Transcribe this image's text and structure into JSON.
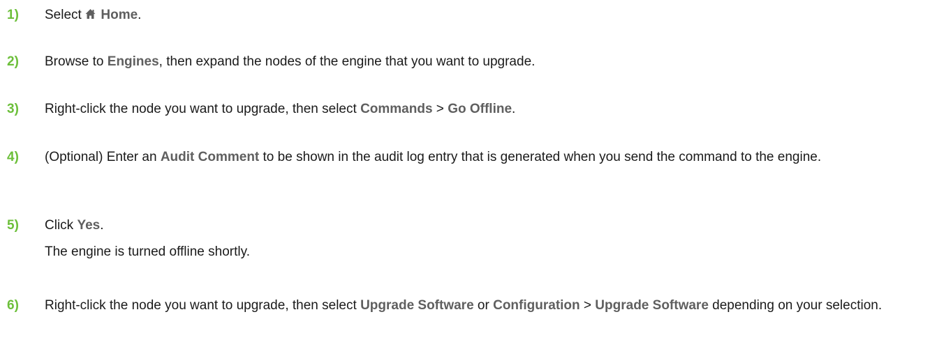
{
  "steps": [
    {
      "number": "1)",
      "parts": [
        {
          "type": "text",
          "text": "Select "
        },
        {
          "type": "icon",
          "icon": "home-icon"
        },
        {
          "type": "ui",
          "text": " Home"
        },
        {
          "type": "text",
          "text": "."
        }
      ]
    },
    {
      "number": "2)",
      "parts": [
        {
          "type": "text",
          "text": "Browse to "
        },
        {
          "type": "ui",
          "text": "Engines"
        },
        {
          "type": "text",
          "text": ", then expand the nodes of the engine that you want to upgrade."
        }
      ]
    },
    {
      "number": "3)",
      "parts": [
        {
          "type": "text",
          "text": "Right-click the node you want to upgrade, then select "
        },
        {
          "type": "ui",
          "text": "Commands"
        },
        {
          "type": "text",
          "text": " > "
        },
        {
          "type": "ui",
          "text": "Go Offline"
        },
        {
          "type": "text",
          "text": "."
        }
      ]
    },
    {
      "number": "4)",
      "parts": [
        {
          "type": "text",
          "text": "(Optional) Enter an "
        },
        {
          "type": "ui",
          "text": "Audit Comment"
        },
        {
          "type": "text",
          "text": " to be shown in the audit log entry that is generated when you send the command to the engine."
        }
      ]
    },
    {
      "number": "5)",
      "parts": [
        {
          "type": "text",
          "text": "Click "
        },
        {
          "type": "ui",
          "text": "Yes"
        },
        {
          "type": "text",
          "text": "."
        }
      ],
      "result": "The engine is turned offline shortly."
    },
    {
      "number": "6)",
      "parts": [
        {
          "type": "text",
          "text": "Right-click the node you want to upgrade, then select "
        },
        {
          "type": "ui",
          "text": "Upgrade Software"
        },
        {
          "type": "text",
          "text": " or "
        },
        {
          "type": "ui",
          "text": "Configuration"
        },
        {
          "type": "text",
          "text": " > "
        },
        {
          "type": "ui",
          "text": "Upgrade Software"
        },
        {
          "type": "text",
          "text": " depending on your selection."
        }
      ]
    }
  ],
  "colors": {
    "step_number": "#6cbf3a",
    "ui_term": "#5f5f5f",
    "body_text": "#1a1a1a"
  }
}
